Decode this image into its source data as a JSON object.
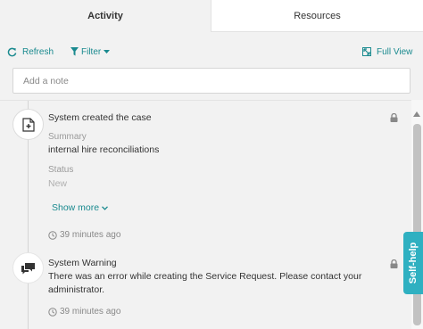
{
  "tabs": [
    {
      "label": "Activity"
    },
    {
      "label": "Resources"
    }
  ],
  "toolbar": {
    "refresh_label": "Refresh",
    "filter_label": "Filter",
    "fullview_label": "Full View"
  },
  "note": {
    "placeholder": "Add a note",
    "value": ""
  },
  "feed": {
    "entries": [
      {
        "title": "System created the case",
        "fields": [
          {
            "label": "Summary",
            "value": "internal hire reconciliations"
          },
          {
            "label": "Status",
            "value": "New"
          }
        ],
        "show_more": "Show more",
        "time": "39 minutes ago",
        "icon": "document-plus-icon"
      },
      {
        "title": "System Warning",
        "message": "There was an error while creating the Service Request. Please contact your administrator.",
        "time": "39 minutes ago",
        "icon": "chat-bubbles-icon"
      }
    ]
  },
  "self_help": {
    "label": "Self-help"
  },
  "colors": {
    "accent": "#1a8a8f",
    "selfhelp_bg": "#2fb0c1",
    "background": "#f2f2f2"
  }
}
